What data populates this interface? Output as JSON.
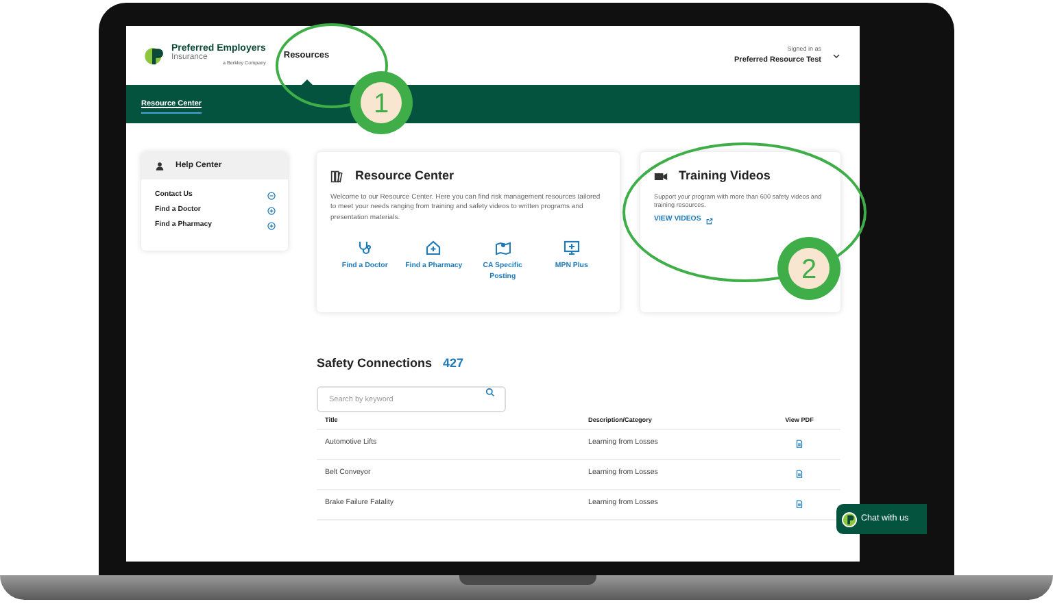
{
  "header": {
    "logo": {
      "name": "Preferred Employers",
      "sub": "Insurance",
      "tagline": "a Berkley Company"
    },
    "nav": [
      {
        "label": "Resources",
        "selected": true
      }
    ],
    "account": {
      "caption": "Signed in as",
      "user": "Preferred Resource Test"
    }
  },
  "subnav": [
    {
      "label": "Resource Center",
      "selected": true
    }
  ],
  "help_center": {
    "title": "Help Center",
    "items": [
      {
        "label": "Contact Us",
        "expanded": true
      },
      {
        "label": "Find a Doctor",
        "expanded": false
      },
      {
        "label": "Find a Pharmacy",
        "expanded": false
      }
    ]
  },
  "resource_center": {
    "title": "Resource Center",
    "description": "Welcome to our Resource Center. Here you can find risk management resources tailored to meet your needs ranging from training and safety videos to written programs and presentation materials.",
    "links": [
      {
        "label": "Find a Doctor"
      },
      {
        "label": "Find a Pharmacy"
      },
      {
        "label": "CA Specific Posting"
      },
      {
        "label": "MPN Plus"
      }
    ]
  },
  "training_videos": {
    "title": "Training Videos",
    "description": "Support your program with more than 600 safety videos and training resources.",
    "link": "VIEW VIDEOS"
  },
  "safety_connections": {
    "title": "Safety Connections",
    "count": "427",
    "search": {
      "placeholder": "Search by keyword"
    },
    "columns": [
      "Title",
      "Description/Category",
      "View PDF"
    ],
    "rows": [
      {
        "title": "Automotive Lifts",
        "category": "Learning from Losses"
      },
      {
        "title": "Belt Conveyor",
        "category": "Learning from Losses"
      },
      {
        "title": "Brake Failure Fatality",
        "category": "Learning from Losses"
      }
    ]
  },
  "chat": {
    "label": "Chat with us"
  },
  "annotations": [
    {
      "label": "1"
    },
    {
      "label": "2"
    }
  ]
}
